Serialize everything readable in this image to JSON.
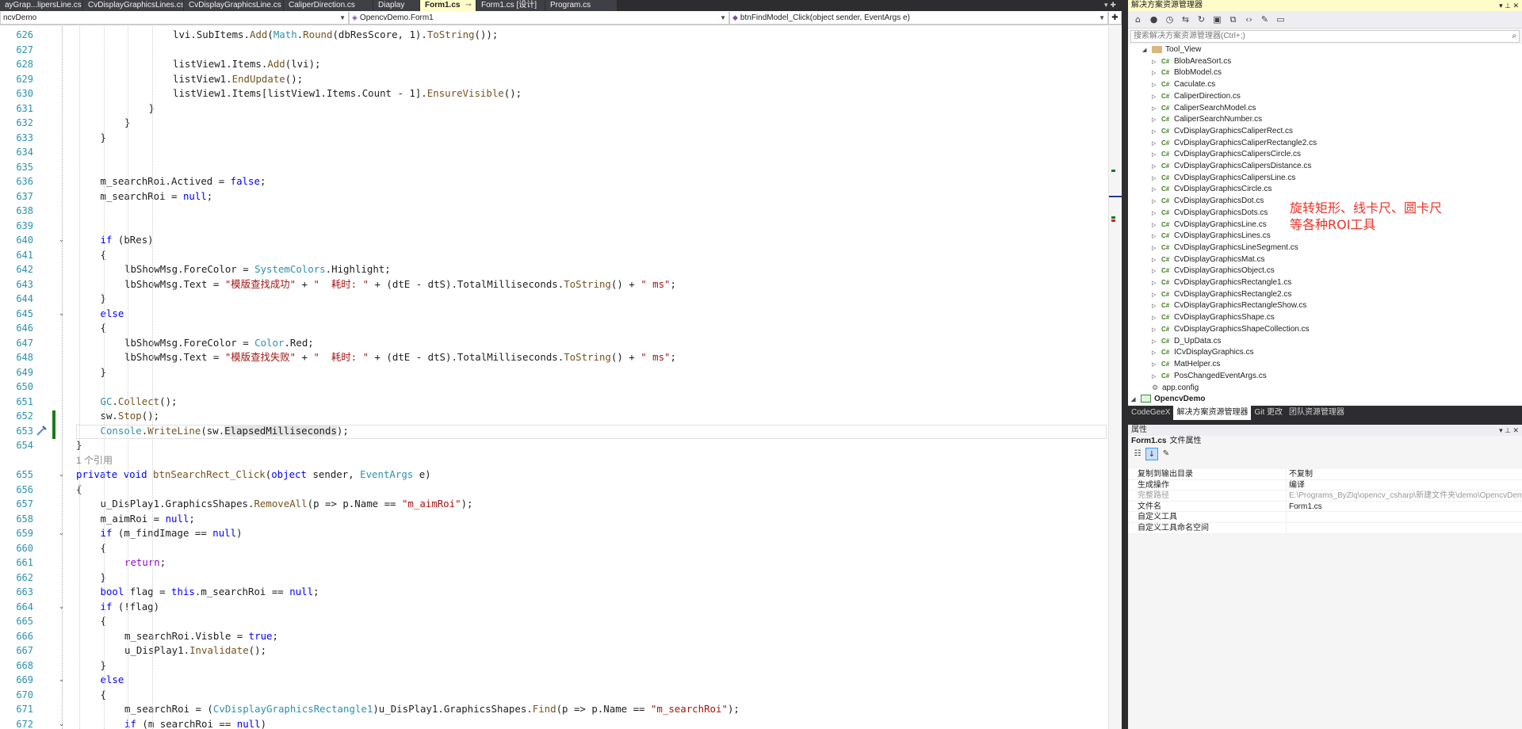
{
  "editor_tabs": [
    {
      "label": "ayGrap...lipersLine.cs",
      "active": false
    },
    {
      "label": "CvDisplayGraphicsLines.cs",
      "active": false
    },
    {
      "label": "CvDisplayGraphicsLine.cs",
      "active": false
    },
    {
      "label": "CaliperDirection.cs",
      "active": false
    },
    {
      "label": "Diaplay",
      "active": false
    },
    {
      "label": "Form1.cs",
      "active": true
    },
    {
      "label": "Form1.cs [设计]",
      "active": false
    },
    {
      "label": "Program.cs",
      "active": false
    }
  ],
  "nav": {
    "project": "ncvDemo",
    "class": "OpencvDemo.Form1",
    "member": "btnFindModel_Click(object sender, EventArgs e)"
  },
  "code_lines": [
    {
      "n": "626",
      "i": 6,
      "t": [
        [
          "",
          "lvi.SubItems."
        ],
        [
          "fn",
          "Add"
        ],
        [
          "",
          "("
        ],
        [
          "ty",
          "Math"
        ],
        [
          "",
          "."
        ],
        [
          "fn",
          "Round"
        ],
        [
          "",
          "(dbResScore, 1)."
        ],
        [
          "fn",
          "ToString"
        ],
        [
          "",
          "());"
        ]
      ]
    },
    {
      "n": "627",
      "i": 6,
      "t": []
    },
    {
      "n": "628",
      "i": 6,
      "t": [
        [
          "",
          "listView1.Items."
        ],
        [
          "fn",
          "Add"
        ],
        [
          "",
          "(lvi);"
        ]
      ]
    },
    {
      "n": "629",
      "i": 6,
      "t": [
        [
          "",
          "listView1."
        ],
        [
          "fn",
          "EndUpdate"
        ],
        [
          "",
          "();"
        ]
      ]
    },
    {
      "n": "630",
      "i": 6,
      "t": [
        [
          "",
          "listView1.Items[listView1.Items.Count - 1]."
        ],
        [
          "fn",
          "EnsureVisible"
        ],
        [
          "",
          "();"
        ]
      ]
    },
    {
      "n": "631",
      "i": 5,
      "t": [
        [
          "",
          "}"
        ]
      ]
    },
    {
      "n": "632",
      "i": 4,
      "t": [
        [
          "",
          "}"
        ]
      ]
    },
    {
      "n": "633",
      "i": 3,
      "t": [
        [
          "",
          "}"
        ]
      ]
    },
    {
      "n": "634",
      "i": 3,
      "t": []
    },
    {
      "n": "635",
      "i": 3,
      "t": []
    },
    {
      "n": "636",
      "i": 3,
      "t": [
        [
          "",
          "m_searchRoi.Actived = "
        ],
        [
          "kw",
          "false"
        ],
        [
          "",
          ";"
        ]
      ]
    },
    {
      "n": "637",
      "i": 3,
      "t": [
        [
          "",
          "m_searchRoi = "
        ],
        [
          "kw",
          "null"
        ],
        [
          "",
          ";"
        ]
      ]
    },
    {
      "n": "638",
      "i": 3,
      "t": []
    },
    {
      "n": "639",
      "i": 3,
      "t": []
    },
    {
      "n": "640",
      "i": 3,
      "t": [
        [
          "kw",
          "if"
        ],
        [
          "",
          " (bRes)"
        ]
      ]
    },
    {
      "n": "641",
      "i": 3,
      "t": [
        [
          "",
          "{"
        ]
      ]
    },
    {
      "n": "642",
      "i": 4,
      "t": [
        [
          "",
          "lbShowMsg.ForeColor = "
        ],
        [
          "ty",
          "SystemColors"
        ],
        [
          "",
          ".Highlight;"
        ]
      ]
    },
    {
      "n": "643",
      "i": 4,
      "t": [
        [
          "",
          "lbShowMsg.Text = "
        ],
        [
          "str",
          "\"模版查找成功\""
        ],
        [
          "",
          " + "
        ],
        [
          "str",
          "\"  耗时: \""
        ],
        [
          "",
          " + (dtE - dtS).TotalMilliseconds."
        ],
        [
          "fn",
          "ToString"
        ],
        [
          "",
          "() + "
        ],
        [
          "str",
          "\" ms\""
        ],
        [
          "",
          ";"
        ]
      ]
    },
    {
      "n": "644",
      "i": 3,
      "t": [
        [
          "",
          "}"
        ]
      ]
    },
    {
      "n": "645",
      "i": 3,
      "t": [
        [
          "kw",
          "else"
        ]
      ]
    },
    {
      "n": "646",
      "i": 3,
      "t": [
        [
          "",
          "{"
        ]
      ]
    },
    {
      "n": "647",
      "i": 4,
      "t": [
        [
          "",
          "lbShowMsg.ForeColor = "
        ],
        [
          "ty",
          "Color"
        ],
        [
          "",
          ".Red;"
        ]
      ]
    },
    {
      "n": "648",
      "i": 4,
      "t": [
        [
          "",
          "lbShowMsg.Text = "
        ],
        [
          "str",
          "\"模版查找失败\""
        ],
        [
          "",
          " + "
        ],
        [
          "str",
          "\"  耗时: \""
        ],
        [
          "",
          " + (dtE - dtS).TotalMilliseconds."
        ],
        [
          "fn",
          "ToString"
        ],
        [
          "",
          "() + "
        ],
        [
          "str",
          "\" ms\""
        ],
        [
          "",
          ";"
        ]
      ]
    },
    {
      "n": "649",
      "i": 3,
      "t": [
        [
          "",
          "}"
        ]
      ]
    },
    {
      "n": "650",
      "i": 3,
      "t": []
    },
    {
      "n": "651",
      "i": 3,
      "t": [
        [
          "ty",
          "GC"
        ],
        [
          "",
          "."
        ],
        [
          "fn",
          "Collect"
        ],
        [
          "",
          "();"
        ]
      ]
    },
    {
      "n": "652",
      "i": 3,
      "t": [
        [
          "",
          "sw."
        ],
        [
          "fn",
          "Stop"
        ],
        [
          "",
          "();"
        ]
      ]
    },
    {
      "n": "653",
      "i": 3,
      "t": [
        [
          "ty",
          "Console"
        ],
        [
          "",
          "."
        ],
        [
          "fn",
          "WriteLine"
        ],
        [
          "",
          "(sw."
        ],
        [
          "hl",
          "ElapsedMilliseconds"
        ],
        [
          "",
          ");"
        ]
      ]
    },
    {
      "n": "654",
      "i": 2,
      "t": [
        [
          "",
          "}"
        ]
      ]
    },
    {
      "n": "",
      "i": 2,
      "t": [
        [
          "lens",
          "1 个引用"
        ]
      ]
    },
    {
      "n": "655",
      "i": 2,
      "t": [
        [
          "kw",
          "private"
        ],
        [
          "",
          " "
        ],
        [
          "kw",
          "void"
        ],
        [
          "",
          " "
        ],
        [
          "fn",
          "btnSearchRect_Click"
        ],
        [
          "",
          "("
        ],
        [
          "kw",
          "object"
        ],
        [
          "",
          " sender, "
        ],
        [
          "ty",
          "EventArgs"
        ],
        [
          "",
          " e)"
        ]
      ]
    },
    {
      "n": "656",
      "i": 2,
      "t": [
        [
          "",
          "{"
        ]
      ]
    },
    {
      "n": "657",
      "i": 3,
      "t": [
        [
          "",
          "u_DisPlay1.GraphicsShapes."
        ],
        [
          "fn",
          "RemoveAll"
        ],
        [
          "",
          "(p => p.Name == "
        ],
        [
          "str",
          "\"m_aimRoi\""
        ],
        [
          "",
          ");"
        ]
      ]
    },
    {
      "n": "658",
      "i": 3,
      "t": [
        [
          "",
          "m_aimRoi = "
        ],
        [
          "kw",
          "null"
        ],
        [
          "",
          ";"
        ]
      ]
    },
    {
      "n": "659",
      "i": 3,
      "t": [
        [
          "kw",
          "if"
        ],
        [
          "",
          " (m_findImage == "
        ],
        [
          "kw",
          "null"
        ],
        [
          "",
          ")"
        ]
      ]
    },
    {
      "n": "660",
      "i": 3,
      "t": [
        [
          "",
          "{"
        ]
      ]
    },
    {
      "n": "661",
      "i": 4,
      "t": [
        [
          "pl",
          "return"
        ],
        [
          "",
          ";"
        ]
      ]
    },
    {
      "n": "662",
      "i": 3,
      "t": [
        [
          "",
          "}"
        ]
      ]
    },
    {
      "n": "663",
      "i": 3,
      "t": [
        [
          "kw",
          "bool"
        ],
        [
          "",
          " flag = "
        ],
        [
          "kw",
          "this"
        ],
        [
          "",
          ".m_searchRoi == "
        ],
        [
          "kw",
          "null"
        ],
        [
          "",
          ";"
        ]
      ]
    },
    {
      "n": "664",
      "i": 3,
      "t": [
        [
          "kw",
          "if"
        ],
        [
          "",
          " (!flag)"
        ]
      ]
    },
    {
      "n": "665",
      "i": 3,
      "t": [
        [
          "",
          "{"
        ]
      ]
    },
    {
      "n": "666",
      "i": 4,
      "t": [
        [
          "",
          "m_searchRoi.Visble = "
        ],
        [
          "kw",
          "true"
        ],
        [
          "",
          ";"
        ]
      ]
    },
    {
      "n": "667",
      "i": 4,
      "t": [
        [
          "",
          "u_DisPlay1."
        ],
        [
          "fn",
          "Invalidate"
        ],
        [
          "",
          "();"
        ]
      ]
    },
    {
      "n": "668",
      "i": 3,
      "t": [
        [
          "",
          "}"
        ]
      ]
    },
    {
      "n": "669",
      "i": 3,
      "t": [
        [
          "kw",
          "else"
        ]
      ]
    },
    {
      "n": "670",
      "i": 3,
      "t": [
        [
          "",
          "{"
        ]
      ]
    },
    {
      "n": "671",
      "i": 4,
      "t": [
        [
          "",
          "m_searchRoi = ("
        ],
        [
          "ty",
          "CvDisplayGraphicsRectangle1"
        ],
        [
          "",
          ")u_DisPlay1.GraphicsShapes."
        ],
        [
          "fn",
          "Find"
        ],
        [
          "",
          "(p => p.Name == "
        ],
        [
          "str",
          "\"m_searchRoi\""
        ],
        [
          "",
          ");"
        ]
      ]
    },
    {
      "n": "672",
      "i": 4,
      "t": [
        [
          "kw",
          "if"
        ],
        [
          "",
          " (m_searchRoi == "
        ],
        [
          "kw",
          "null"
        ],
        [
          "",
          ")"
        ]
      ]
    }
  ],
  "solution_explorer": {
    "title": "解决方案资源管理器",
    "search_placeholder": "搜索解决方案资源管理器(Ctrl+;)",
    "tree": [
      {
        "label": "Tool_View",
        "kind": "folder",
        "level": 1,
        "expanded": true
      },
      {
        "label": "BlobAreaSort.cs",
        "kind": "cs",
        "level": 2
      },
      {
        "label": "BlobModel.cs",
        "kind": "cs",
        "level": 2
      },
      {
        "label": "Caculate.cs",
        "kind": "cs",
        "level": 2
      },
      {
        "label": "CaliperDirection.cs",
        "kind": "cs",
        "level": 2
      },
      {
        "label": "CaliperSearchModel.cs",
        "kind": "cs",
        "level": 2
      },
      {
        "label": "CaliperSearchNumber.cs",
        "kind": "cs",
        "level": 2
      },
      {
        "label": "CvDisplayGraphicsCaliperRect.cs",
        "kind": "cs",
        "level": 2
      },
      {
        "label": "CvDisplayGraphicsCaliperRectangle2.cs",
        "kind": "cs",
        "level": 2
      },
      {
        "label": "CvDisplayGraphicsCalipersCircle.cs",
        "kind": "cs",
        "level": 2
      },
      {
        "label": "CvDisplayGraphicsCalipersDistance.cs",
        "kind": "cs",
        "level": 2
      },
      {
        "label": "CvDisplayGraphicsCalipersLine.cs",
        "kind": "cs",
        "level": 2
      },
      {
        "label": "CvDisplayGraphicsCircle.cs",
        "kind": "cs",
        "level": 2
      },
      {
        "label": "CvDisplayGraphicsDot.cs",
        "kind": "cs",
        "level": 2
      },
      {
        "label": "CvDisplayGraphicsDots.cs",
        "kind": "cs",
        "level": 2
      },
      {
        "label": "CvDisplayGraphicsLine.cs",
        "kind": "cs",
        "level": 2
      },
      {
        "label": "CvDisplayGraphicsLines.cs",
        "kind": "cs",
        "level": 2
      },
      {
        "label": "CvDisplayGraphicsLineSegment.cs",
        "kind": "cs",
        "level": 2
      },
      {
        "label": "CvDisplayGraphicsMat.cs",
        "kind": "cs",
        "level": 2
      },
      {
        "label": "CvDisplayGraphicsObject.cs",
        "kind": "cs",
        "level": 2
      },
      {
        "label": "CvDisplayGraphicsRectangle1.cs",
        "kind": "cs",
        "level": 2
      },
      {
        "label": "CvDisplayGraphicsRectangle2.cs",
        "kind": "cs",
        "level": 2
      },
      {
        "label": "CvDisplayGraphicsRectangleShow.cs",
        "kind": "cs",
        "level": 2
      },
      {
        "label": "CvDisplayGraphicsShape.cs",
        "kind": "cs",
        "level": 2
      },
      {
        "label": "CvDisplayGraphicsShapeCollection.cs",
        "kind": "cs",
        "level": 2
      },
      {
        "label": "D_UpData.cs",
        "kind": "cs",
        "level": 2
      },
      {
        "label": "ICvDisplayGraphics.cs",
        "kind": "cs",
        "level": 2
      },
      {
        "label": "MatHelper.cs",
        "kind": "cs",
        "level": 2
      },
      {
        "label": "PosChangedEventArgs.cs",
        "kind": "cs",
        "level": 2
      },
      {
        "label": "app.config",
        "kind": "config",
        "level": 1
      },
      {
        "label": "OpencvDemo",
        "kind": "project",
        "level": 0,
        "expanded": true
      }
    ],
    "annotation": "旋转矩形、线卡尺、圆卡尺\n等各种ROI工具",
    "annotation_color": "#e8342a",
    "bottom_tabs": [
      "CodeGeeX",
      "解决方案资源管理器",
      "Git 更改",
      "团队资源管理器"
    ],
    "active_bottom_tab": 1
  },
  "properties": {
    "title": "属性",
    "subject_name": "Form1.cs",
    "subject_type": "文件属性",
    "rows": [
      {
        "key": "复制到输出目录",
        "value": "不复制",
        "dim": false
      },
      {
        "key": "生成操作",
        "value": "编译",
        "dim": false
      },
      {
        "key": "完整路径",
        "value": "E:\\Programs_ByZlq\\opencv_csharp\\新建文件夹\\demo\\OpencvDem",
        "dim": true
      },
      {
        "key": "文件名",
        "value": "Form1.cs",
        "dim": false
      },
      {
        "key": "自定义工具",
        "value": "",
        "dim": false
      },
      {
        "key": "自定义工具命名空间",
        "value": "",
        "dim": false
      }
    ]
  },
  "colors": {
    "keyword": "#0000ff",
    "type": "#2b91af",
    "string": "#a31515",
    "method": "#74531f",
    "control": "#8f08c4",
    "line_number": "#2b91af",
    "active_tab": "#fefcc8",
    "chrome_dark": "#2d2d30"
  }
}
